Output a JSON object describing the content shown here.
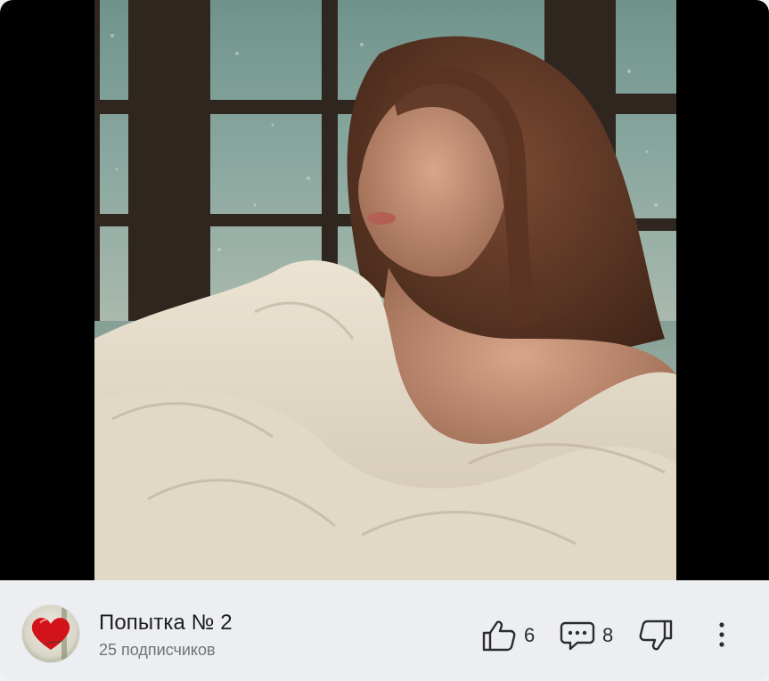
{
  "video": {
    "description_icon": "video-frame"
  },
  "channel": {
    "name": "Попытка № 2",
    "subscribers": "25 подписчиков",
    "avatar_icon": "heart-avatar-icon"
  },
  "actions": {
    "likes": "6",
    "comments": "8",
    "like_icon": "thumbs-up-icon",
    "comment_icon": "comment-icon",
    "dislike_icon": "thumbs-down-icon",
    "more_icon": "more-vertical-icon"
  },
  "colors": {
    "footer_bg": "#edeef1",
    "video_bg": "#000000",
    "title_text": "#1b1c1f",
    "muted_text": "#6f7378"
  }
}
